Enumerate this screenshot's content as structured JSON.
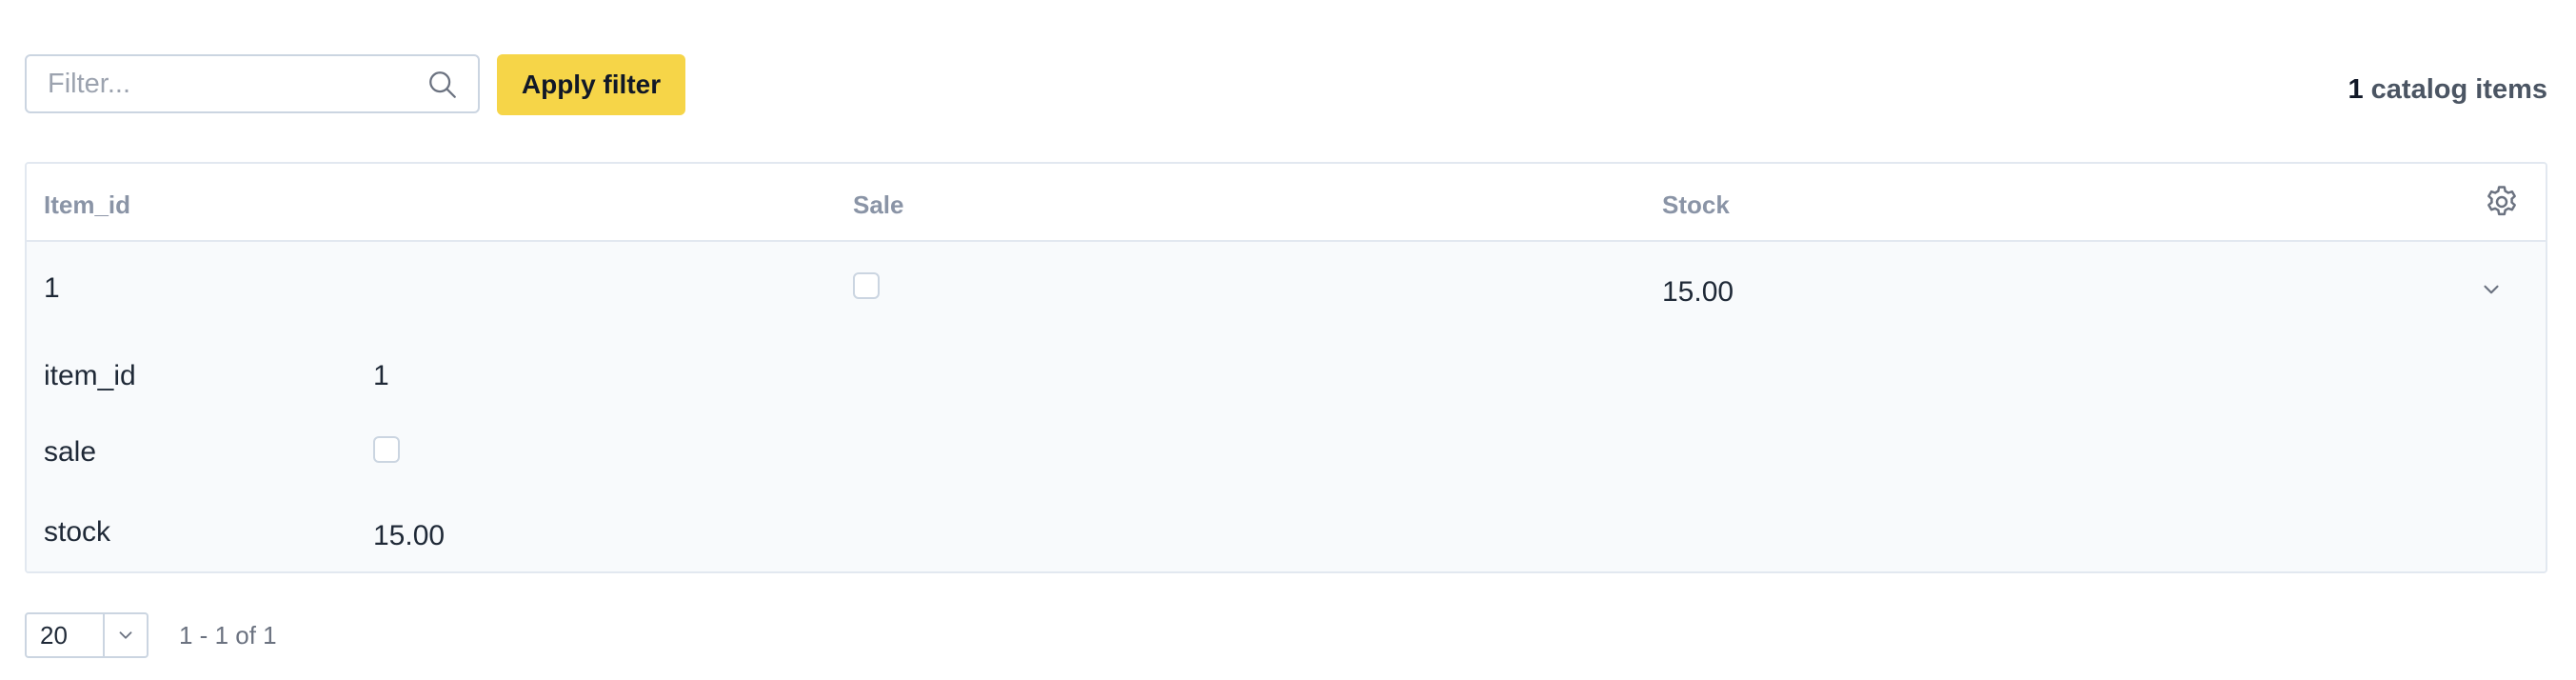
{
  "toolbar": {
    "filter_placeholder": "Filter...",
    "filter_value": "",
    "apply_label": "Apply filter",
    "item_count": "1",
    "item_count_label": "catalog items"
  },
  "table": {
    "columns": [
      "Item_id",
      "Sale",
      "Stock"
    ],
    "rows": [
      {
        "item_id": "1",
        "sale": false,
        "stock": "15.00",
        "expanded": true,
        "details": [
          {
            "label": "item_id",
            "value": "1"
          },
          {
            "label": "sale",
            "value": false
          },
          {
            "label": "stock",
            "value": "15.00"
          }
        ]
      }
    ]
  },
  "pagination": {
    "page_size": "20",
    "range": "1 - 1 of 1"
  },
  "colors": {
    "accent": "#f6d548",
    "border": "#e2e8f0",
    "muted_text": "#8a94a6",
    "row_background": "#f8fafc"
  },
  "icons": {
    "search": "search-icon",
    "settings": "gear-icon",
    "expand": "chevron-down-icon",
    "dropdown": "chevron-down-icon"
  }
}
